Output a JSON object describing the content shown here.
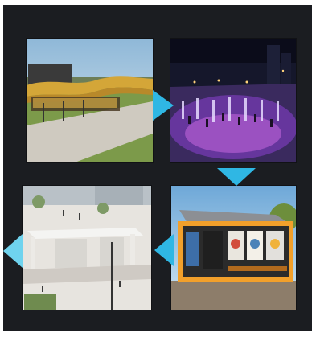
{
  "panels": [
    {
      "id": "1",
      "label": "",
      "icon": "pavilion-scene"
    },
    {
      "id": "2",
      "label": "",
      "icon": "fountain-plaza-night"
    },
    {
      "id": "3",
      "label": "",
      "icon": "orange-kiosk"
    },
    {
      "id": "4",
      "label": "",
      "icon": "white-pavilion-street"
    }
  ],
  "colors": {
    "background": "#1b1d21",
    "arrow": "#2fb7e4",
    "arrow_light": "#6fd3ee"
  }
}
